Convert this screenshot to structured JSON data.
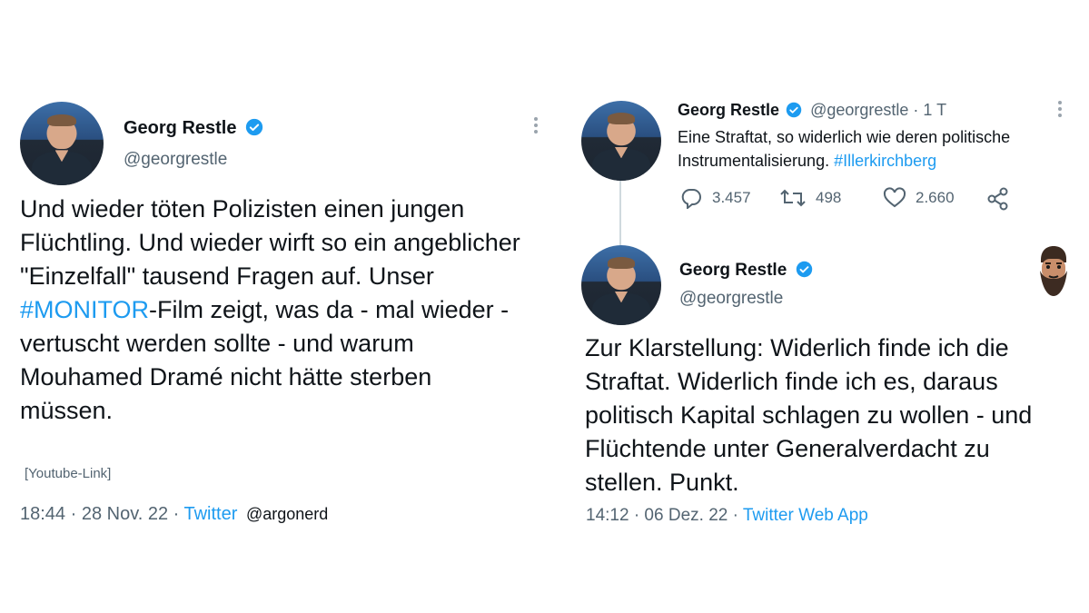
{
  "tweet_left": {
    "name": "Georg Restle",
    "handle": "@georgrestle",
    "text_before": "Und wieder töten Polizisten einen jungen Flüchtling. Und wieder wirft so ein angeblicher \"Einzelfall\" tausend Fragen auf. Unser ",
    "hashtag": "#MONITOR",
    "text_after": "-Film zeigt, was da - mal wieder - vertuscht werden sollte - und warum Mouhamed Dramé nicht hätte sterben müssen.",
    "link_placeholder": "[Youtube-Link]",
    "time": "18:44 · 28 Nov. 22 · ",
    "source": "Twitter",
    "watermark": "@argonerd"
  },
  "tweet_right_top": {
    "name": "Georg Restle",
    "handle": "@georgrestle · 1 T",
    "text_line1": "Eine Straftat, so widerlich wie deren politische",
    "text_line2_prefix": "Instrumentalisierung. ",
    "hashtag": "#Illerkirchberg",
    "replies": "3.457",
    "retweets": "498",
    "likes": "2.660"
  },
  "tweet_right_bottom": {
    "name": "Georg Restle",
    "handle": "@georgrestle",
    "text": "Zur Klarstellung: Widerlich finde ich die Straftat. Widerlich finde ich es, daraus politisch Kapital schlagen zu wollen - und Flüchtende unter Generalverdacht zu stellen. Punkt.",
    "time": "14:12 · 06 Dez. 22 · ",
    "source": "Twitter Web App"
  },
  "colors": {
    "link": "#1d9bf0",
    "text": "#0f1419",
    "muted": "#536471"
  },
  "icons": [
    "verified-badge-icon",
    "more-options-icon",
    "reply-icon",
    "retweet-icon",
    "like-icon",
    "share-icon",
    "bearded-man-emoji-icon"
  ]
}
